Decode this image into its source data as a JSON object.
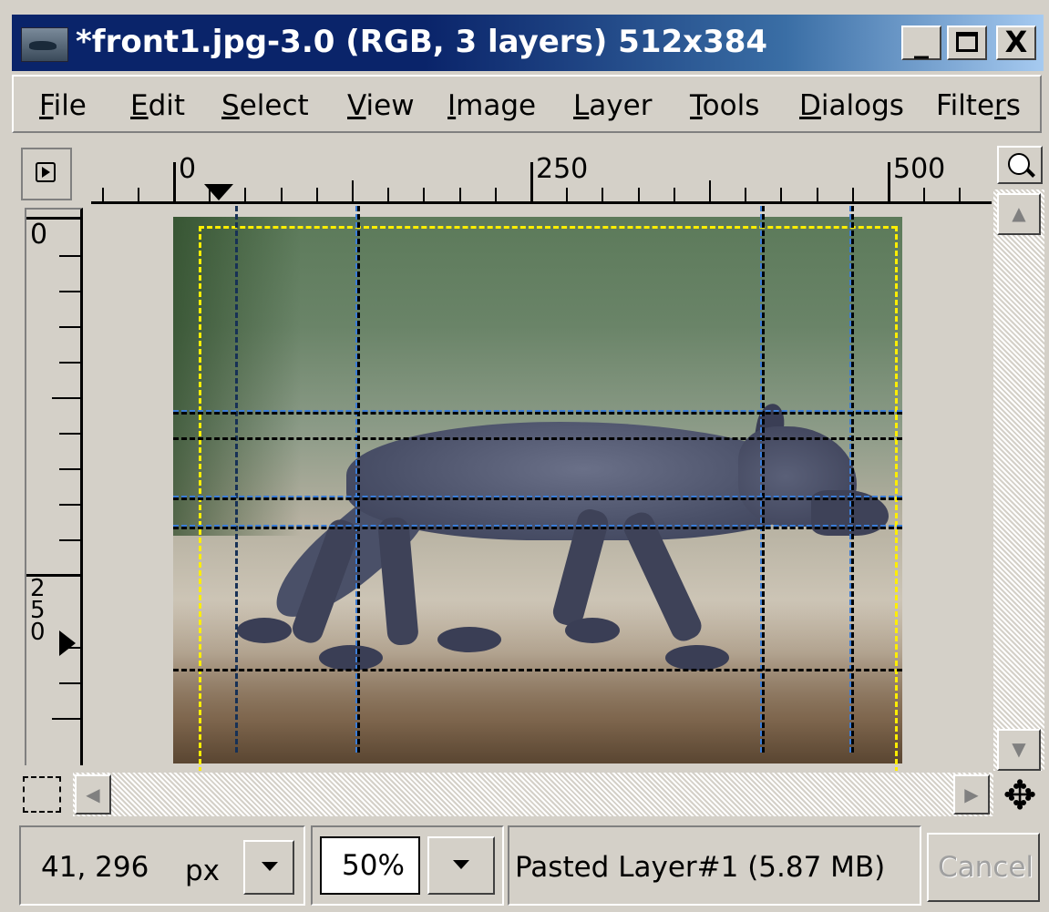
{
  "window": {
    "title": "*front1.jpg-3.0 (RGB, 3 layers) 512x384",
    "controls": {
      "minimize": "_",
      "maximize": "□",
      "close": "X"
    }
  },
  "menubar": {
    "items": [
      {
        "label": "File",
        "mnemonic": "F"
      },
      {
        "label": "Edit",
        "mnemonic": "E"
      },
      {
        "label": "Select",
        "mnemonic": "S"
      },
      {
        "label": "View",
        "mnemonic": "V"
      },
      {
        "label": "Image",
        "mnemonic": "I"
      },
      {
        "label": "Layer",
        "mnemonic": "L"
      },
      {
        "label": "Tools",
        "mnemonic": "T"
      },
      {
        "label": "Dialogs",
        "mnemonic": "D"
      },
      {
        "label": "Filters",
        "mnemonic": "r"
      }
    ]
  },
  "rulers": {
    "horizontal_labels": [
      "0",
      "250",
      "500"
    ],
    "vertical_labels": [
      "0",
      "250"
    ]
  },
  "icons": {
    "corner": "menu-arrow-icon",
    "zoom": "zoom-icon",
    "quickmask": "quickmask-icon",
    "navigate": "navigate-move-icon"
  },
  "statusbar": {
    "coordinates": "41, 296",
    "unit": "px",
    "zoom": "50%",
    "message": "Pasted Layer#1 (5.87 MB)",
    "cancel_label": "Cancel"
  },
  "colors": {
    "titlebar_start": "#0a246a",
    "titlebar_end": "#a6caf0",
    "window_bg": "#d4d0c8",
    "guide_black": "#000000",
    "guide_blue": "#3b7dd8",
    "layer_boundary": "#ffee00"
  }
}
